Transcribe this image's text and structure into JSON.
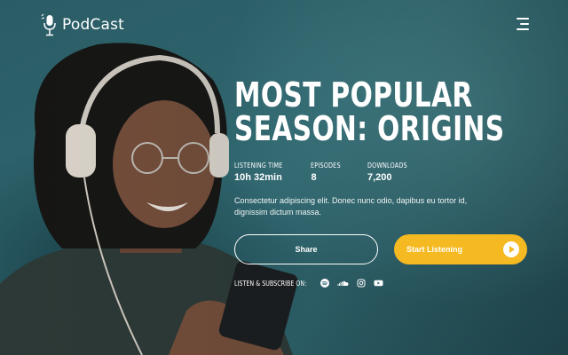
{
  "header": {
    "brand": "PodCast",
    "logo_icon": "microphone-icon",
    "menu_icon": "hamburger-menu-icon"
  },
  "hero": {
    "title_line1": "MOST POPULAR",
    "title_line2": "SEASON: ORIGINS",
    "stats": [
      {
        "label": "LISTENING TIME",
        "value": "10h 32min"
      },
      {
        "label": "EPISODES",
        "value": "8"
      },
      {
        "label": "DOWNLOADS",
        "value": "7,200"
      }
    ],
    "description": "Consectetur adipiscing elit. Donec nunc odio, dapibus eu tortor id, dignissim dictum massa.",
    "share_label": "Share",
    "listen_label": "Start Listening",
    "subscribe_label": "LISTEN & SUBSCRIBE ON:",
    "social_icons": [
      "spotify-icon",
      "soundcloud-icon",
      "instagram-icon",
      "youtube-icon"
    ]
  },
  "colors": {
    "accent": "#f5b921",
    "background": "#35717a",
    "text": "#ffffff"
  }
}
